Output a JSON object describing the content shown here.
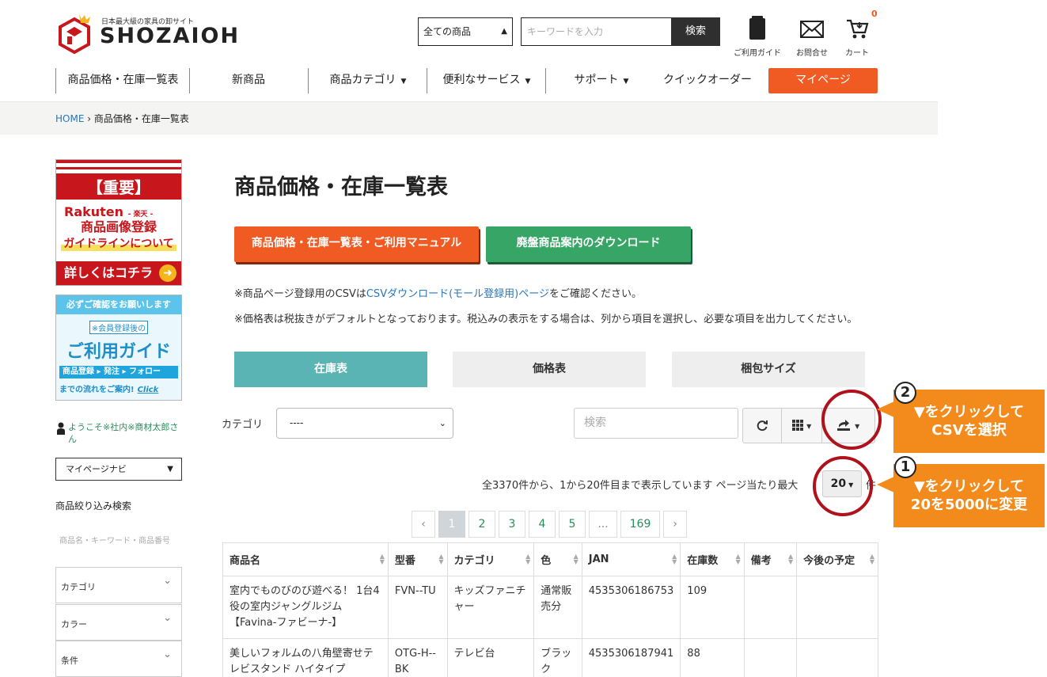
{
  "header": {
    "tagline": "日本最大級の家具の卸サイト",
    "brand": "SHOZAIOH",
    "search_category": "全ての商品",
    "search_placeholder": "キーワードを入力",
    "search_button": "検索",
    "guide_label": "ご利用ガイド",
    "contact_label": "お問合せ",
    "cart_label": "カート",
    "cart_count": "0"
  },
  "nav": {
    "price_list": "商品価格・在庫一覧表",
    "new": "新商品",
    "category": "商品カテゴリ",
    "services": "便利なサービス",
    "support": "サポート",
    "quick_order": "クイックオーダー",
    "mypage": "マイページ"
  },
  "breadcrumb": {
    "home": "HOME",
    "sep": " › ",
    "current": "商品価格・在庫一覧表"
  },
  "sidebar": {
    "banner_important": {
      "head": "【重要】",
      "rakuten": "Rakuten",
      "rakuten_sub": "- 楽天 -",
      "line1": "商品画像登録",
      "line2": "ガイドラインについて",
      "foot": "詳しくはコチラ"
    },
    "banner_guide": {
      "top": "必ずご確認をお願いします",
      "sub": "※会員登録後の",
      "main": "ご利用ガイド",
      "flow": "商品登録 ▸ 発注 ▸ フォロー",
      "foot": "までの流れをご案内!",
      "click": "Click"
    },
    "welcome": "ようこそ※社内※商材太郎さん",
    "mypage_navi": "マイページナビ",
    "filter_title": "商品絞り込み検索",
    "filter_keyword": "商品名・キーワード・商品番号",
    "facets": [
      "カテゴリ",
      "カラー",
      "条件"
    ]
  },
  "main": {
    "title": "商品価格・在庫一覧表",
    "manual_button": "商品価格・在庫一覧表・ご利用マニュアル",
    "discontinued_button": "廃盤商品案内のダウンロード",
    "note1_prefix": "※商品ページ登録用のCSVは",
    "note1_link": "CSVダウンロード(モール登録用)ページ",
    "note1_suffix": "をご確認ください。",
    "note2": "※価格表は税抜きがデフォルトとなっております。税込みの表示をする場合は、列から項目を選択し、必要な項目を出力してください。",
    "tabs": [
      {
        "label": "在庫表",
        "active": true
      },
      {
        "label": "価格表",
        "active": false
      },
      {
        "label": "梱包サイズ",
        "active": false
      }
    ],
    "category_label": "カテゴリ",
    "category_value": "----",
    "table_search_placeholder": "検索",
    "pager_info": "全3370件から、1から20件目まで表示しています ページ当たり最大",
    "per_page": "20",
    "per_page_suffix": "件",
    "pages": [
      "‹",
      "1",
      "2",
      "3",
      "4",
      "5",
      "...",
      "169",
      "›"
    ],
    "table": {
      "headers": [
        "商品名",
        "型番",
        "カテゴリ",
        "色",
        "JAN",
        "在庫数",
        "備考",
        "今後の予定"
      ],
      "rows": [
        [
          "室内でものびのび遊べる！ 1台4役の室内ジャングルジム【Favina-ファビーナ-】",
          "FVN--TU",
          "キッズファニチャー",
          "通常販売分",
          "4535306186753",
          "109",
          "",
          ""
        ],
        [
          "美しいフォルムの八角壁寄せテレビスタンド ハイタイプ",
          "OTG-H--BK",
          "テレビ台",
          "ブラック",
          "4535306187941",
          "88",
          "",
          ""
        ]
      ]
    }
  },
  "annotations": {
    "step1_num": "1",
    "step1_text": "▼をクリックして\n20を5000に変更",
    "step2_num": "2",
    "step2_text": "▼をクリックして\nCSVを選択",
    "ring_color": "#b0121b",
    "callout_color": "#f28b1c"
  }
}
